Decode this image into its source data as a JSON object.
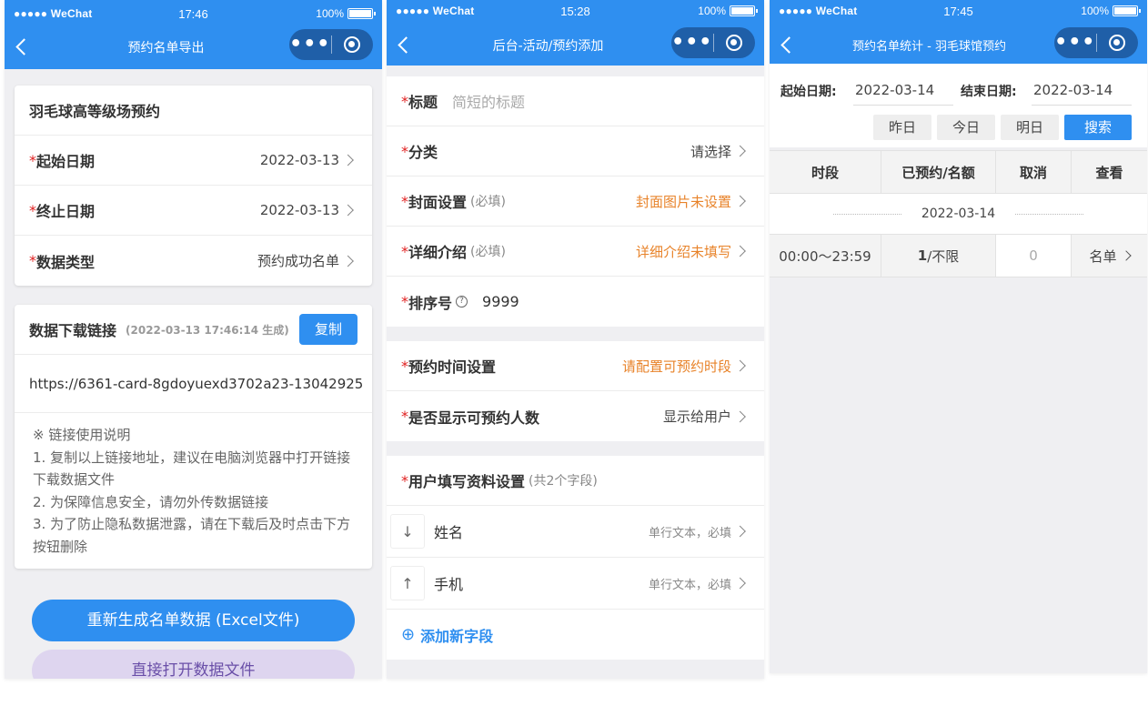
{
  "status": {
    "p1": {
      "carrier": "●●●●● WeChat",
      "time": "17:46",
      "battery": "100%"
    },
    "p2": {
      "carrier": "●●●●● WeChat",
      "time": "15:28",
      "battery": "100%"
    },
    "p3": {
      "carrier": "●●●●● WeChat",
      "time": "17:45",
      "battery": "100%"
    }
  },
  "nav": {
    "p1_title": "预约名单导出",
    "p2_title": "后台-活动/预约添加",
    "p3_title": "预约名单统计 - 羽毛球馆预约",
    "capsule_dots": "•••"
  },
  "export": {
    "event_title": "羽毛球高等级场预约",
    "rows": [
      {
        "req": "*",
        "label": "起始日期",
        "value": "2022-03-13"
      },
      {
        "req": "*",
        "label": "终止日期",
        "value": "2022-03-13"
      },
      {
        "req": "*",
        "label": "数据类型",
        "value": "预约成功名单"
      }
    ],
    "download_title": "数据下载链接",
    "generated": "(2022-03-13 17:46:14 生成)",
    "copy_label": "复制",
    "link": "https://6361-card-8gdoyuexd3702a23-13042925",
    "notes": [
      "※ 链接使用说明",
      "1. 复制以上链接地址，建议在电脑浏览器中打开链接下载数据文件",
      "2. 为保障信息安全，请勿外传数据链接",
      "3. 为了防止隐私数据泄露，请在下载后及时点击下方按钮删除"
    ],
    "regen_label": "重新生成名单数据 (Excel文件)",
    "open_label": "直接打开数据文件"
  },
  "add": {
    "title_label": "标题",
    "title_placeholder": "简短的标题",
    "category_label": "分类",
    "category_value": "请选择",
    "cover_label": "封面设置",
    "cover_hint": "(必填)",
    "cover_value": "封面图片未设置",
    "detail_label": "详细介绍",
    "detail_hint": "(必填)",
    "detail_value": "详细介绍未填写",
    "order_label": "排序号",
    "order_icon": "?",
    "order_value": "9999",
    "time_label": "预约时间设置",
    "time_value": "请配置可预约时段",
    "show_label": "是否显示可预约人数",
    "show_value": "显示给用户",
    "fields_label": "用户填写资料设置",
    "fields_hint": "(共2个字段)",
    "fields": [
      {
        "arrow": "↓",
        "name": "姓名",
        "meta": "单行文本，必填"
      },
      {
        "arrow": "↑",
        "name": "手机",
        "meta": "单行文本，必填"
      }
    ],
    "add_field_icon": "⊕",
    "add_field_label": "添加新字段",
    "req": "*"
  },
  "stats": {
    "start_label": "起始日期:",
    "start_value": "2022-03-14",
    "end_label": "结束日期:",
    "end_value": "2022-03-14",
    "buttons": [
      "昨日",
      "今日",
      "明日",
      "搜索"
    ],
    "headers": [
      "时段",
      "已预约/名额",
      "取消",
      "查看"
    ],
    "date_group": "2022-03-14",
    "row": {
      "slot": "00:00～23:59",
      "booked": "1",
      "quota": "/不限",
      "cancel": "0",
      "view": "名单"
    }
  }
}
